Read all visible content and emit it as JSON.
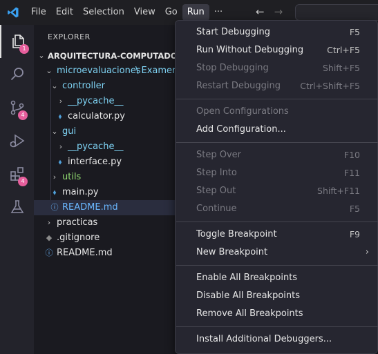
{
  "menubar": {
    "items": [
      {
        "label": "File"
      },
      {
        "label": "Edit"
      },
      {
        "label": "Selection"
      },
      {
        "label": "View"
      },
      {
        "label": "Go"
      },
      {
        "label": "Run",
        "active": true
      },
      {
        "label": "···"
      }
    ]
  },
  "navigation": {
    "back_icon": "←",
    "forward_icon": "→"
  },
  "activitybar": {
    "explorer_badge": "1",
    "source_control_badge": "4",
    "extensions_badge": "4"
  },
  "explorer": {
    "title": "EXPLORER",
    "root": "ARQUITECTURA-COMPUTADOR",
    "tree": [
      {
        "label": "microevaluaciones",
        "path_suffix": "\\ Examen-p"
      },
      {
        "label": "controller"
      },
      {
        "label": "__pycache__"
      },
      {
        "label": "calculator.py"
      },
      {
        "label": "gui"
      },
      {
        "label": "__pycache__"
      },
      {
        "label": "interface.py"
      },
      {
        "label": "utils"
      },
      {
        "label": "main.py"
      },
      {
        "label": "README.md"
      },
      {
        "label": "practicas"
      },
      {
        "label": ".gitignore"
      },
      {
        "label": "README.md"
      }
    ]
  },
  "run_menu": {
    "items": [
      {
        "label": "Start Debugging",
        "shortcut": "F5",
        "enabled": true
      },
      {
        "label": "Run Without Debugging",
        "shortcut": "Ctrl+F5",
        "enabled": true
      },
      {
        "label": "Stop Debugging",
        "shortcut": "Shift+F5",
        "enabled": false
      },
      {
        "label": "Restart Debugging",
        "shortcut": "Ctrl+Shift+F5",
        "enabled": false
      },
      {
        "label": "Open Configurations",
        "shortcut": "",
        "enabled": false
      },
      {
        "label": "Add Configuration...",
        "shortcut": "",
        "enabled": true
      },
      {
        "label": "Step Over",
        "shortcut": "F10",
        "enabled": false
      },
      {
        "label": "Step Into",
        "shortcut": "F11",
        "enabled": false
      },
      {
        "label": "Step Out",
        "shortcut": "Shift+F11",
        "enabled": false
      },
      {
        "label": "Continue",
        "shortcut": "F5",
        "enabled": false
      },
      {
        "label": "Toggle Breakpoint",
        "shortcut": "F9",
        "enabled": true
      },
      {
        "label": "New Breakpoint",
        "shortcut": "",
        "enabled": true,
        "submenu": true
      },
      {
        "label": "Enable All Breakpoints",
        "shortcut": "",
        "enabled": true
      },
      {
        "label": "Disable All Breakpoints",
        "shortcut": "",
        "enabled": true
      },
      {
        "label": "Remove All Breakpoints",
        "shortcut": "",
        "enabled": true
      },
      {
        "label": "Install Additional Debuggers...",
        "shortcut": "",
        "enabled": true
      }
    ]
  },
  "colors": {
    "accent": "#e65e9c",
    "folder_text": "#7fd4f5",
    "python_icon": "#4f9fd8",
    "utils_text": "#8fd86f",
    "readme_text": "#6ab7ff"
  }
}
